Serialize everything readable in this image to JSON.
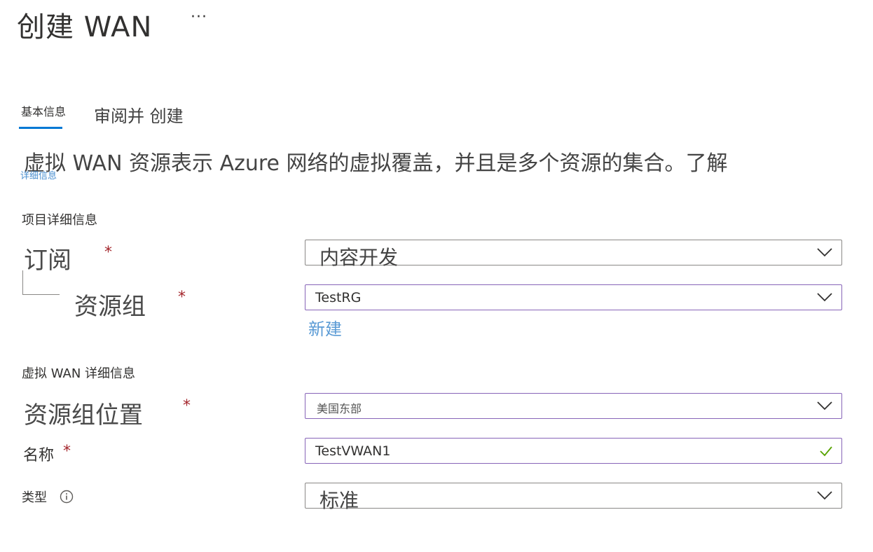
{
  "page": {
    "title": "创建 WAN",
    "more_label": "···"
  },
  "tabs": [
    {
      "label": "基本信息",
      "selected": true
    },
    {
      "label": "审阅并 创建",
      "selected": false
    }
  ],
  "description": {
    "text": "虚拟 WAN 资源表示 Azure 网络的虚拟覆盖，并且是多个资源的集合。了解",
    "link": "详细信息"
  },
  "project_details": {
    "heading": "项目详细信息",
    "subscription": {
      "label": "订阅",
      "required_mark": "*",
      "value": "内容开发"
    },
    "resource_group": {
      "label": "资源组",
      "required_mark": "*",
      "value": "TestRG",
      "create_new": "新建"
    }
  },
  "wan_details": {
    "heading": "虚拟 WAN 详细信息",
    "location": {
      "label": "资源组位置",
      "required_mark": "*",
      "value": "美国东部"
    },
    "name": {
      "label": "名称",
      "required_mark": "*",
      "value": "TestVWAN1",
      "valid": true
    },
    "type": {
      "label": "类型",
      "value": "标准"
    }
  },
  "icons": {
    "more": "ellipsis-icon",
    "dropdown": "chevron-down-icon",
    "valid": "checkmark-icon",
    "info": "info-icon"
  },
  "colors": {
    "accent": "#0078d4",
    "required": "#a4262c",
    "link": "#5b9bd5",
    "valid": "#57a300",
    "focus_border": "#8764b8"
  }
}
